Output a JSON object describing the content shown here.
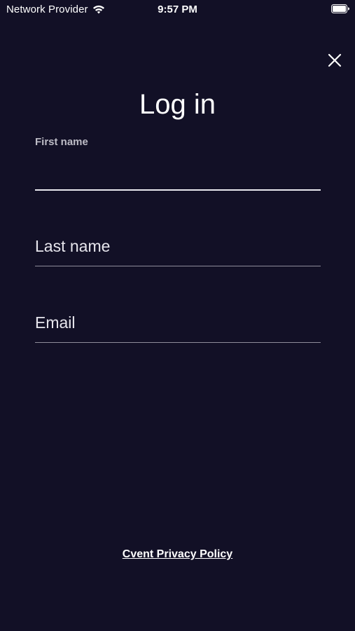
{
  "status_bar": {
    "carrier": "Network Provider",
    "time": "9:57 PM",
    "wifi_icon": "wifi-icon",
    "battery_icon": "battery-full-icon"
  },
  "header": {
    "close_icon": "close-icon",
    "title": "Log in"
  },
  "form": {
    "first_name": {
      "label": "First name",
      "value": ""
    },
    "last_name": {
      "placeholder": "Last name",
      "value": ""
    },
    "email": {
      "placeholder": "Email",
      "value": ""
    }
  },
  "footer": {
    "privacy_link": "Cvent Privacy Policy"
  },
  "colors": {
    "background": "#121026",
    "text": "#ffffff",
    "label": "#bdbcc6",
    "underline_inactive": "#8e8c9a",
    "underline_active": "#e9e8ef"
  }
}
